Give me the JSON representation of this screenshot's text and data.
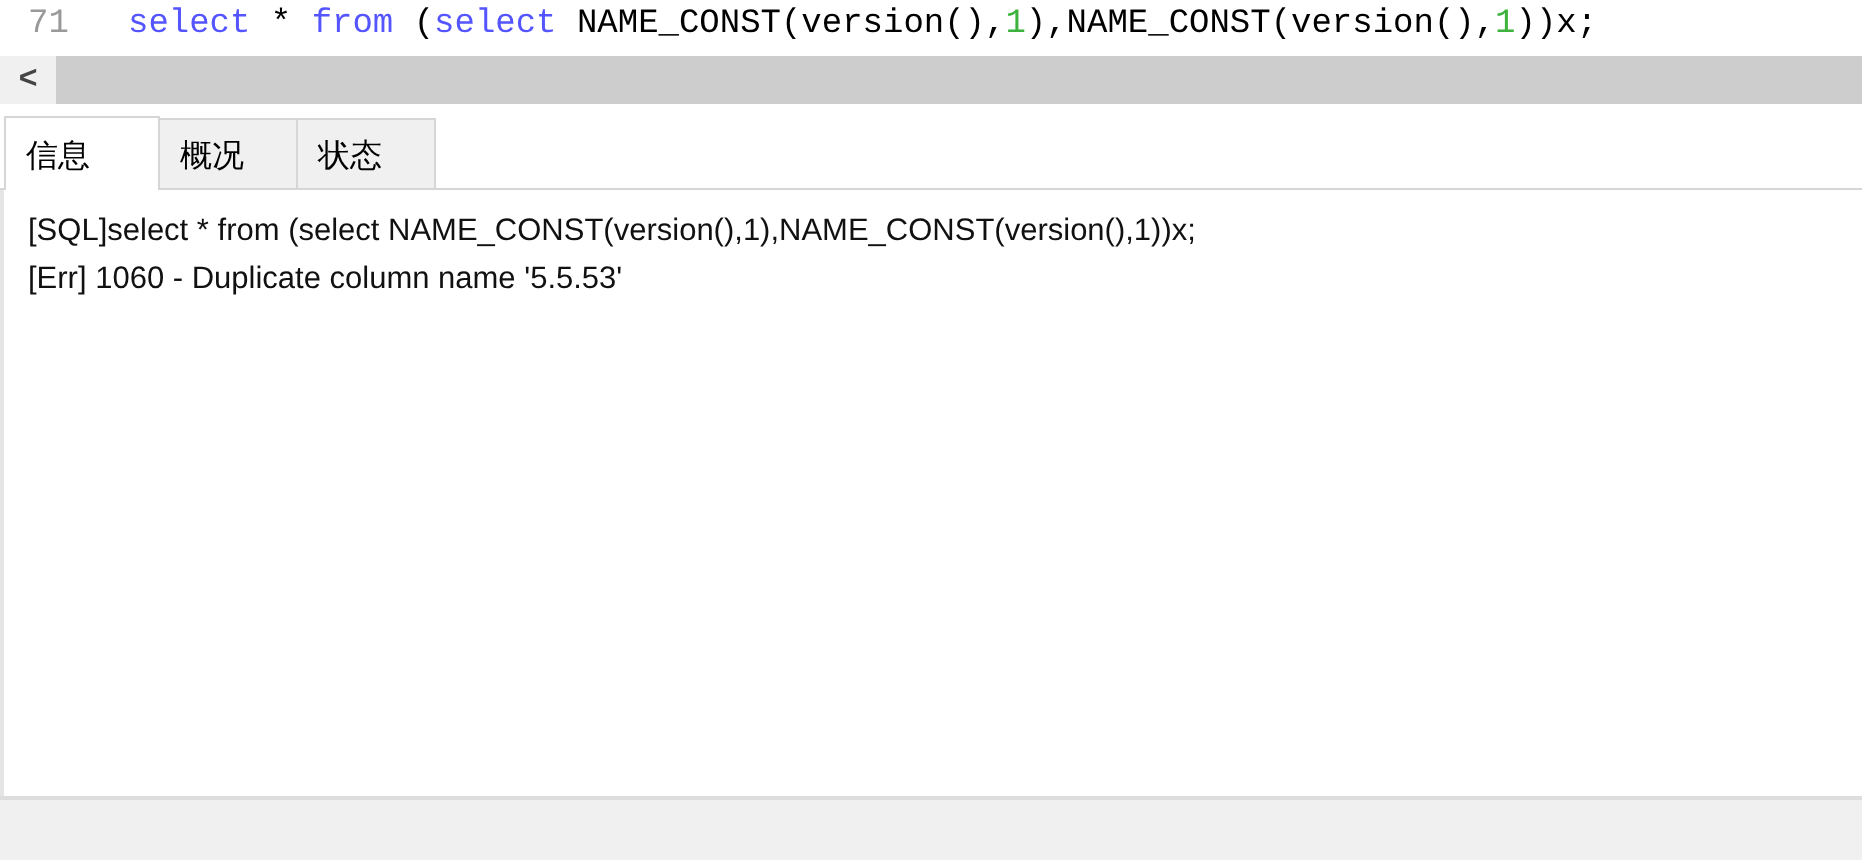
{
  "editor": {
    "line_number": "71",
    "tokens": [
      {
        "kind": "keyword",
        "text": "select"
      },
      {
        "kind": "plain",
        "text": " * "
      },
      {
        "kind": "keyword",
        "text": "from"
      },
      {
        "kind": "plain",
        "text": " ("
      },
      {
        "kind": "keyword",
        "text": "select"
      },
      {
        "kind": "plain",
        "text": " NAME_CONST(version(),"
      },
      {
        "kind": "number",
        "text": "1"
      },
      {
        "kind": "plain",
        "text": "),NAME_CONST(version(),"
      },
      {
        "kind": "number",
        "text": "1"
      },
      {
        "kind": "plain",
        "text": "))x;"
      }
    ]
  },
  "scrollbar": {
    "arrow": "<"
  },
  "tabs": [
    {
      "label": "信息",
      "selected": true
    },
    {
      "label": "概况",
      "selected": false
    },
    {
      "label": "状态",
      "selected": false
    }
  ],
  "messages": [
    "[SQL]select * from (select NAME_CONST(version(),1),NAME_CONST(version(),1))x;",
    "[Err] 1060 - Duplicate column name '5.5.53'"
  ]
}
